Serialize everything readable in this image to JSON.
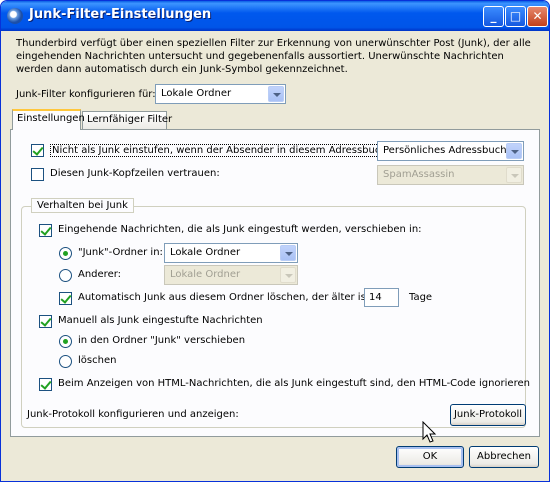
{
  "window": {
    "title": "Junk-Filter-Einstellungen",
    "buttons": {
      "minimize": "_",
      "maximize": "□",
      "close": "✕"
    }
  },
  "intro": "Thunderbird verfügt über einen speziellen Filter zur Erkennung von unerwünschter Post (Junk), der alle eingehenden Nachrichten untersucht und gegebenenfalls aussortiert. Unerwünschte Nachrichten werden dann automatisch durch ein Junk-Symbol gekennzeichnet.",
  "configure_for": {
    "label": "Junk-Filter konfigurieren für:",
    "value": "Lokale Ordner"
  },
  "tabs": [
    {
      "label": "Einstellungen"
    },
    {
      "label": "Lernfähiger Filter"
    }
  ],
  "settings": {
    "addressbook": {
      "label": "Nicht als Junk einstufen, wenn der Absender in diesem Adressbuch ist:",
      "checked": true,
      "select": "Persönliches Adressbuch"
    },
    "headers": {
      "label": "Diesen Junk-Kopfzeilen vertrauen:",
      "checked": false,
      "select": "SpamAssassin"
    },
    "group": {
      "legend": "Verhalten bei Junk",
      "move_incoming": {
        "label": "Eingehende Nachrichten, die als Junk eingestuft werden, verschieben in:",
        "checked": true
      },
      "junk_folder": {
        "label": "\"Junk\"-Ordner in:",
        "checked": true,
        "select": "Lokale Ordner"
      },
      "other": {
        "label": "Anderer:",
        "checked": false,
        "select": "Lokale Ordner"
      },
      "auto_delete": {
        "label_before": "Automatisch Junk aus diesem Ordner löschen, der älter ist als",
        "days": "14",
        "label_after": "Tage",
        "checked": true
      },
      "manual": {
        "label": "Manuell als Junk eingestufte Nachrichten",
        "checked": true
      },
      "move_to_junk": {
        "label": "in den Ordner \"Junk\" verschieben",
        "checked": true
      },
      "delete": {
        "label": "löschen",
        "checked": false
      },
      "html": {
        "label": "Beim Anzeigen von HTML-Nachrichten, die als Junk eingestuft sind, den HTML-Code ignorieren",
        "checked": true
      }
    },
    "log": {
      "label": "Junk-Protokoll konfigurieren und anzeigen:",
      "button": "Junk-Protokoll"
    }
  },
  "footer": {
    "ok": "OK",
    "cancel": "Abbrechen"
  }
}
